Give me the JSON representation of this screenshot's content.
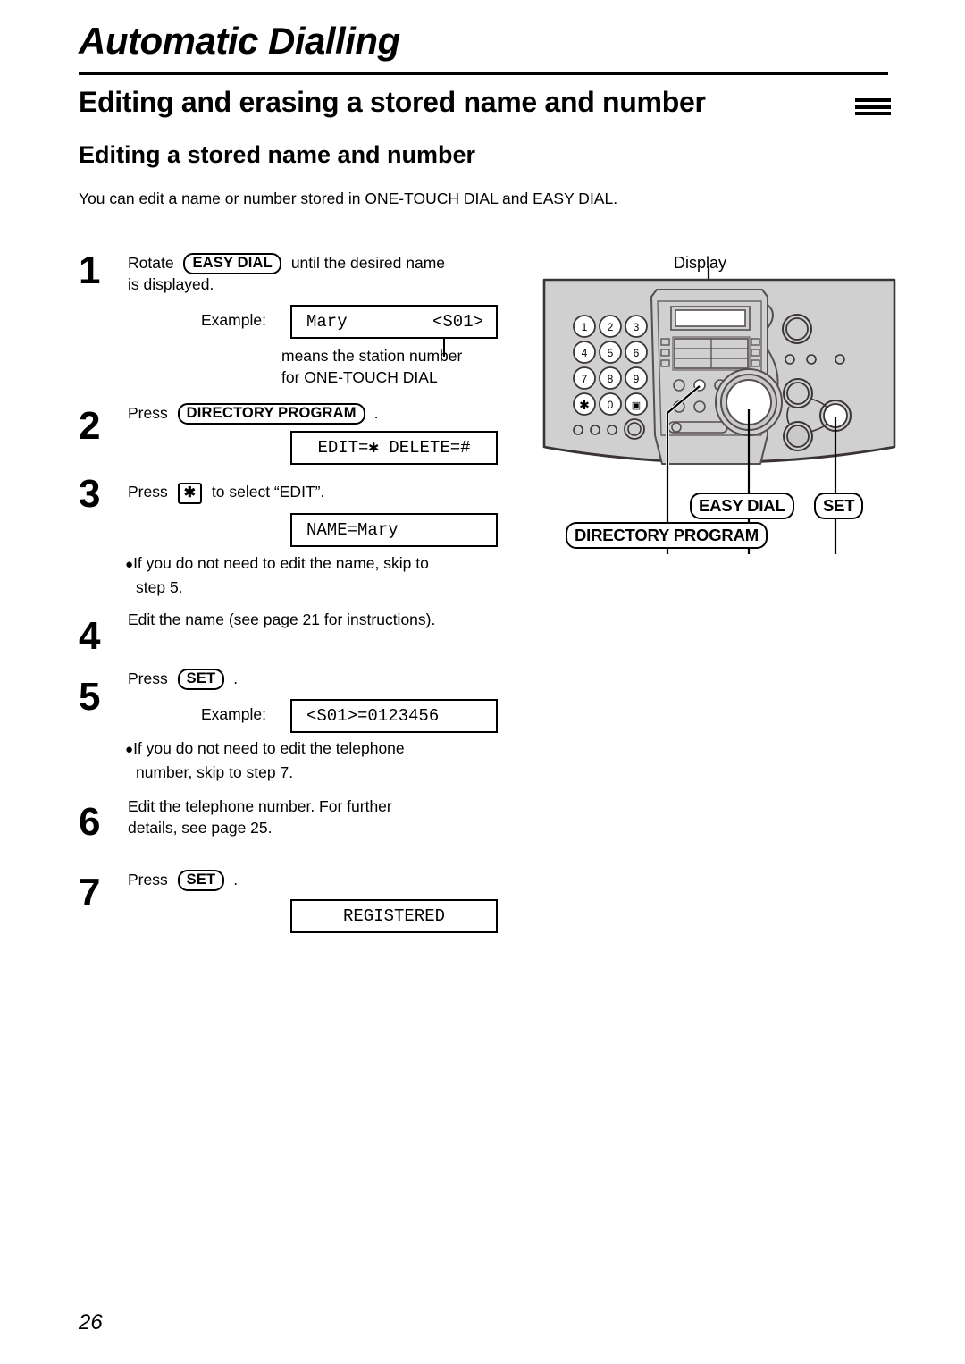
{
  "page": {
    "chapter_title": "Automatic Dialling",
    "section_title": "Editing and erasing a stored name and number",
    "subsection_title": "Editing a stored name and number",
    "intro": "You can edit a name or number stored in ONE-TOUCH DIAL and EASY DIAL.",
    "page_number": "26"
  },
  "steps": [
    {
      "number": "1",
      "text_before_key": "Rotate",
      "key": "EASY DIAL",
      "text_after_key": "until the desired name",
      "line2": "is displayed.",
      "example_label": "Example:",
      "lcd_left": "Mary",
      "lcd_right": "<S01>",
      "annotation_line1": "means the station number",
      "annotation_line2": "for ONE-TOUCH DIAL"
    },
    {
      "number": "2",
      "text_before_key": "Press",
      "key": "DIRECTORY PROGRAM",
      "text_after_key": ".",
      "lcd": "EDIT=✱ DELETE=#"
    },
    {
      "number": "3",
      "text_before_key": "Press",
      "key": "✱",
      "text_after_key": "to select “EDIT”.",
      "lcd": "NAME=Mary",
      "note": "If you do not need to edit the name, skip to",
      "note_line2": "step 5."
    },
    {
      "number": "4",
      "text": "Edit the name (see page 21 for instructions)."
    },
    {
      "number": "5",
      "text_before_key": "Press",
      "key": "SET",
      "text_after_key": ".",
      "example_label": "Example:",
      "lcd": "<S01>=0123456",
      "note": "If you do not need to edit the telephone",
      "note_line2": "number, skip to step 7."
    },
    {
      "number": "6",
      "text": "Edit the telephone number. For further",
      "line2": "details, see page 25."
    },
    {
      "number": "7",
      "text_before_key": "Press",
      "key": "SET",
      "text_after_key": ".",
      "lcd": "REGISTERED"
    }
  ],
  "diagram": {
    "display_label": "Display",
    "callouts": {
      "easy_dial": "EASY DIAL",
      "set": "SET",
      "directory_program": "DIRECTORY PROGRAM"
    },
    "keypad": [
      "1",
      "2",
      "3",
      "4",
      "5",
      "6",
      "7",
      "8",
      "9",
      "✱",
      "0",
      "☐"
    ]
  },
  "colors": {
    "ink": "#000000",
    "paper": "#ffffff",
    "panel_fill": "#d0d0d0",
    "panel_outline": "#3a3338",
    "key_fill": "#ffffff"
  }
}
